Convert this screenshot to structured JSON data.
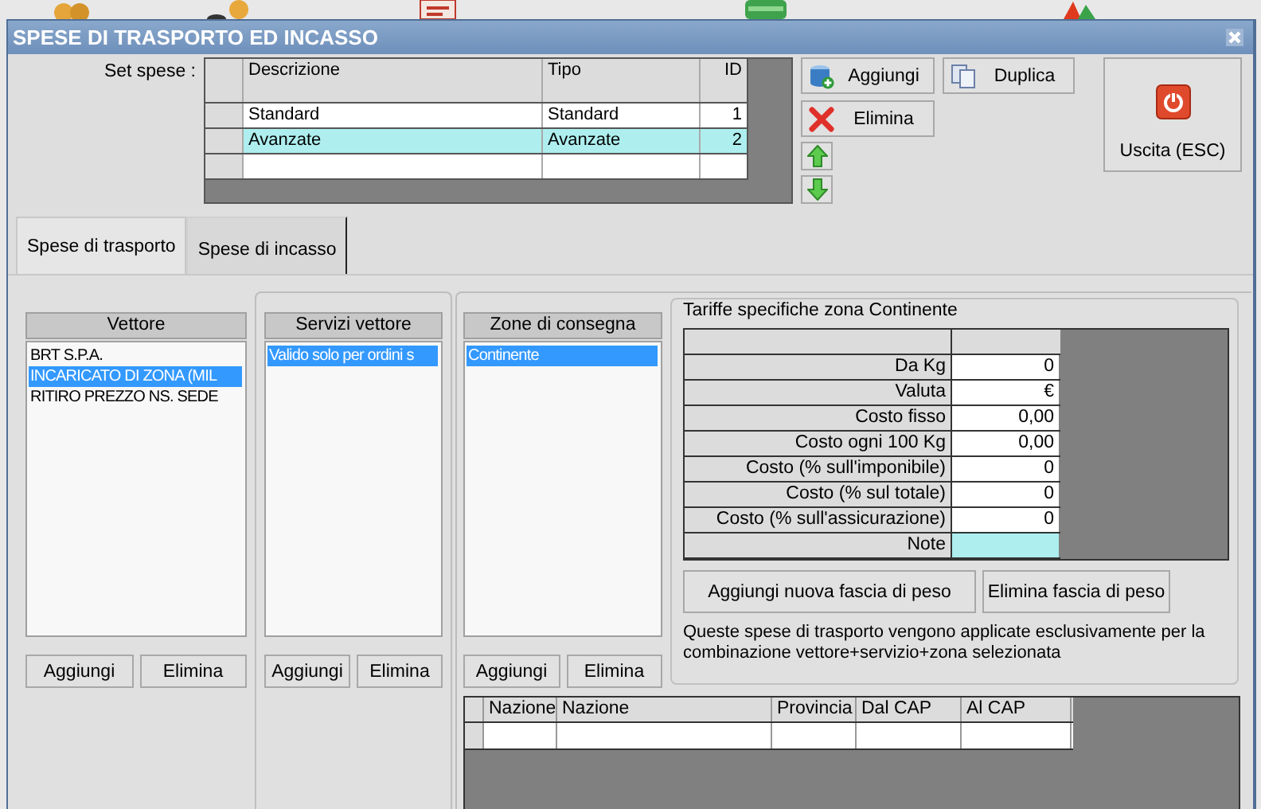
{
  "window": {
    "title": "SPESE DI TRASPORTO ED INCASSO"
  },
  "set_spese": {
    "label": "Set spese :",
    "columns": [
      "Descrizione",
      "Tipo",
      "ID"
    ],
    "rows": [
      {
        "descrizione": "Standard",
        "tipo": "Standard",
        "id": "1",
        "selected": false
      },
      {
        "descrizione": "Avanzate",
        "tipo": "Avanzate",
        "id": "2",
        "selected": true
      }
    ]
  },
  "actions": {
    "add": "Aggiungi",
    "duplicate": "Duplica",
    "delete": "Elimina",
    "exit": "Uscita (ESC)"
  },
  "tabs": [
    {
      "label": "Spese di trasporto",
      "selected": true
    },
    {
      "label": "Spese di incasso",
      "selected": false
    }
  ],
  "lists": [
    {
      "title": "Vettore",
      "items": [
        {
          "label": "BRT S.P.A.",
          "selected": false
        },
        {
          "label": "INCARICATO DI ZONA (MIL",
          "selected": true
        },
        {
          "label": "RITIRO PREZZO NS. SEDE",
          "selected": false
        }
      ],
      "buttons": [
        "Aggiungi",
        "Elimina"
      ]
    },
    {
      "title": "Servizi vettore",
      "items": [
        {
          "label": "Valido solo per ordini s",
          "selected": true
        }
      ],
      "buttons": [
        "Aggiungi",
        "Elimina"
      ]
    },
    {
      "title": "Zone di consegna",
      "items": [
        {
          "label": "Continente",
          "selected": true
        }
      ],
      "buttons": [
        "Aggiungi",
        "Elimina"
      ]
    }
  ],
  "tariffe": {
    "title": "Tariffe specifiche zona Continente",
    "rows": [
      {
        "label": "Da Kg",
        "value": "0",
        "selected": false
      },
      {
        "label": "Valuta",
        "value": "€",
        "selected": false
      },
      {
        "label": "Costo fisso",
        "value": "0,00",
        "selected": false
      },
      {
        "label": "Costo ogni 100 Kg",
        "value": "0,00",
        "selected": false
      },
      {
        "label": "Costo (% sull'imponibile)",
        "value": "0",
        "selected": false
      },
      {
        "label": "Costo (% sul totale)",
        "value": "0",
        "selected": false
      },
      {
        "label": "Costo (% sull'assicurazione)",
        "value": "0",
        "selected": false
      },
      {
        "label": "Note",
        "selected": true
      }
    ],
    "buttons": [
      "Aggiungi nuova fascia di peso",
      "Elimina fascia di peso"
    ],
    "note": "Queste spese di trasporto vengono applicate esclusivamente per la combinazione vettore+servizio+zona selezionata"
  },
  "zone_table": {
    "columns": [
      "Nazione",
      "Nazione",
      "Provincia",
      "Dal CAP",
      "Al CAP"
    ]
  }
}
